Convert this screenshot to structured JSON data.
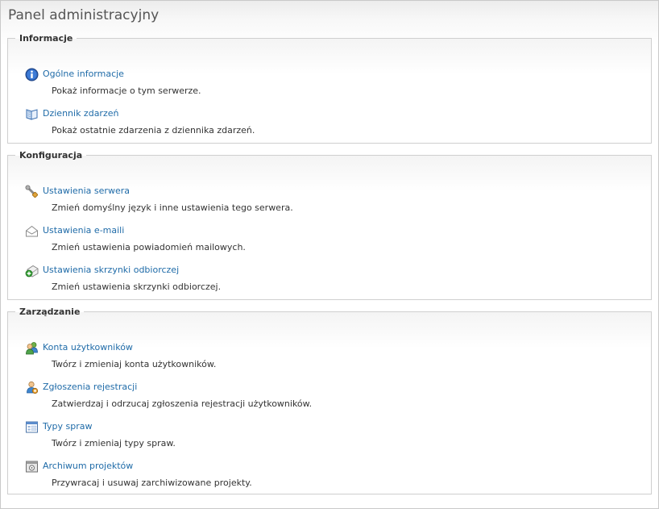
{
  "title": "Panel administracyjny",
  "sections": [
    {
      "legend": "Informacje",
      "items": [
        {
          "label": "Ogólne informacje",
          "desc": "Pokaż informacje o tym serwerze.",
          "icon": "info-icon"
        },
        {
          "label": "Dziennik zdarzeń",
          "desc": "Pokaż ostatnie zdarzenia z dziennika zdarzeń.",
          "icon": "book-icon"
        }
      ]
    },
    {
      "legend": "Konfiguracja",
      "items": [
        {
          "label": "Ustawienia serwera",
          "desc": "Zmień domyślny język i inne ustawienia tego serwera.",
          "icon": "wrench-icon"
        },
        {
          "label": "Ustawienia e-maili",
          "desc": "Zmień ustawienia powiadomień mailowych.",
          "icon": "envelope-icon"
        },
        {
          "label": "Ustawienia skrzynki odbiorczej",
          "desc": "Zmień ustawienia skrzynki odbiorczej.",
          "icon": "inbox-add-icon"
        }
      ]
    },
    {
      "legend": "Zarządzanie",
      "items": [
        {
          "label": "Konta użytkowników",
          "desc": "Twórz i zmieniaj konta użytkowników.",
          "icon": "users-icon"
        },
        {
          "label": "Zgłoszenia rejestracji",
          "desc": "Zatwierdzaj i odrzucaj zgłoszenia rejestracji użytkowników.",
          "icon": "user-register-icon"
        },
        {
          "label": "Typy spraw",
          "desc": "Twórz i zmieniaj typy spraw.",
          "icon": "form-icon"
        },
        {
          "label": "Archiwum projektów",
          "desc": "Przywracaj i usuwaj zarchiwizowane projekty.",
          "icon": "archive-icon"
        }
      ]
    }
  ]
}
